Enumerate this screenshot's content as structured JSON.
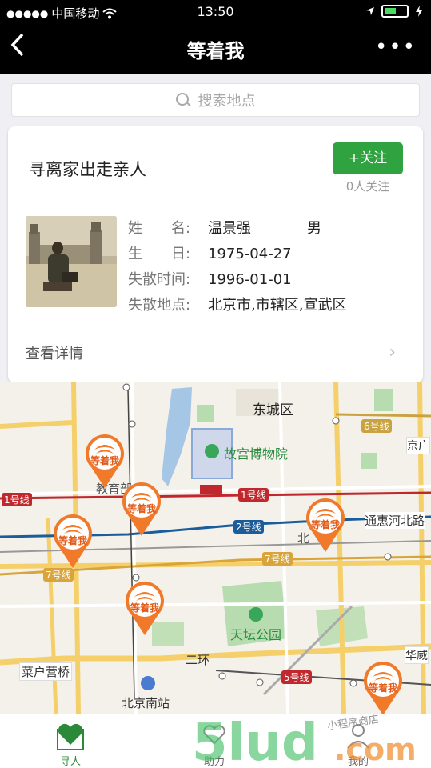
{
  "status_bar": {
    "carrier": "中国移动",
    "time": "13:50"
  },
  "nav": {
    "back_icon": "‹",
    "title": "等着我",
    "more_icon": "•••"
  },
  "search": {
    "placeholder": "搜索地点"
  },
  "card": {
    "title": "寻离家出走亲人",
    "follow_label": "+关注",
    "follow_count": "0人关注",
    "fields": [
      {
        "label": "姓　　名:",
        "value": "温景强",
        "extra": "男"
      },
      {
        "label": "生　　日:",
        "value": "1975-04-27",
        "extra": ""
      },
      {
        "label": "失散时间:",
        "value": "1996-01-01",
        "extra": ""
      },
      {
        "label": "失散地点:",
        "value": "北京市,市辖区,宣武区",
        "extra": ""
      }
    ],
    "detail_link": "查看详情",
    "chevron_icon": "›"
  },
  "map": {
    "labels": {
      "dongcheng": "东城区",
      "gugong": "故宫博物院",
      "tiantan": "天坛公园",
      "caihukou": "菜户营桥",
      "nanzhan": "北京南站",
      "tonghui": "通惠河北路",
      "erhuan": "二环",
      "jingguang": "京广",
      "huawei": "华威",
      "jiaoyu": "教育部",
      "bei": "北"
    },
    "road_labels": {
      "line1a": "1号线",
      "line1b": "1号线",
      "line2": "2号线",
      "line6": "6号线",
      "line7a": "7号线",
      "line7b": "7号线",
      "line5": "5号线"
    },
    "marker_label": "等着我",
    "marker_color": "#f07a2a"
  },
  "tabs": [
    {
      "label": "寻人",
      "active": true
    },
    {
      "label": "助力",
      "active": false
    },
    {
      "label": "我的",
      "active": false
    }
  ],
  "watermark": {
    "text": "5lud.com",
    "sub": "小程序商店"
  }
}
